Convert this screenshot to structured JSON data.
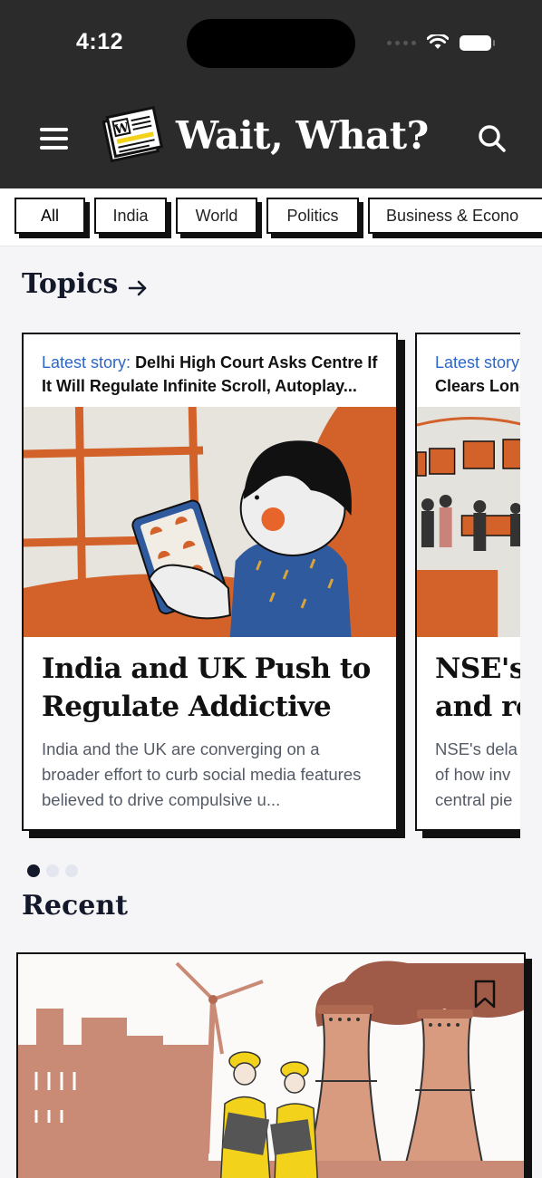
{
  "status_bar": {
    "time": "4:12"
  },
  "header": {
    "brand_title": "Wait, What?",
    "logo_letter": "W",
    "colors": {
      "background": "#2b2b2b",
      "text": "#ffffff",
      "logo_accent": "#f2d21b"
    }
  },
  "categories": [
    {
      "label": "All",
      "active": true
    },
    {
      "label": "India",
      "active": false
    },
    {
      "label": "World",
      "active": false
    },
    {
      "label": "Politics",
      "active": false
    },
    {
      "label": "Business & Econo",
      "active": false
    }
  ],
  "topics": {
    "heading": "Topics",
    "cards": [
      {
        "latest_label": "Latest story:",
        "latest_text": "Delhi High Court Asks Centre If It Will Regulate Infinite Scroll, Autoplay...",
        "title": "India and UK Push to Regulate Addictive S...",
        "description": "India and the UK are converging on a broader effort to curb social media features believed to drive compulsive u..."
      },
      {
        "latest_label": "Latest story",
        "latest_text": "Clears Long",
        "title": "NSE's and re",
        "description": "NSE's dela of how inv central pie"
      }
    ],
    "pager": {
      "count": 3,
      "active": 0
    }
  },
  "recent": {
    "heading": "Recent"
  },
  "icons": {
    "menu": "hamburger-menu-icon",
    "search": "search-icon",
    "topics_arrow": "arrow-right-icon",
    "bookmark": "bookmark-icon"
  },
  "colors": {
    "accent_blue": "#2b66c9",
    "ink": "#14182b",
    "illustration_orange": "#d2622a",
    "illustration_blue": "#2f5a9e"
  }
}
